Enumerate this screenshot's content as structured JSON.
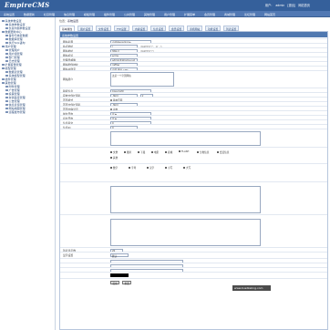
{
  "header": {
    "logo": "EmpireCMS",
    "user_prefix": "用户：",
    "user": "admin",
    "links": [
      "[退出]",
      "网站首页"
    ]
  },
  "nav": [
    "系统设置",
    "数据更新",
    "栏目管理",
    "信息管理",
    "模板管理",
    "插件管理",
    "公共管理",
    "其他管理",
    "用户管理",
    "扩展菜单",
    "会员管理",
    "商城管理",
    "论坛管理",
    "网站首页"
  ],
  "sidebar": {
    "items": [
      "系统参数设置",
      "系统参数设置",
      "负载均衡参数设置",
      "数据更新中心",
      "备份与恢复数据",
      "数据库管理",
      "执行SQL语句",
      "用户管理",
      "管理用户",
      "用户组管理",
      "部门管理",
      "日志管理",
      "扩展变量管理",
      "模型管理",
      "数据表管理",
      "系统模型管理",
      "插件管理",
      "其他管理",
      "附件管理",
      "广告管理",
      "投票管理",
      "友情链接管理",
      "公告管理",
      "信息反馈管理",
      "网站地图管理",
      "远程发布管理"
    ]
  },
  "crumb": {
    "prefix": "位置：",
    "path": "系统设置"
  },
  "tabs": [
    "基本属性",
    "用户设置",
    "文件设置",
    "FTP设置",
    "内容设置",
    "信息设置",
    "会员设置",
    "手机网站",
    "功能设置",
    "列表设置"
  ],
  "form": {
    "heading": "系统参数设置",
    "rows": [
      {
        "label": "网站名称",
        "value": "帝国网站管理系统"
      },
      {
        "label": "站点地址",
        "value": "/"
      },
      {
        "label": "网站地址",
        "value": "http://"
      },
      {
        "label": "网站标识",
        "value": "ecms"
      },
      {
        "label": "管理员邮箱",
        "value": "admin@phome.net"
      },
      {
        "label": "网站附件地址",
        "value": "/d/file/"
      },
      {
        "label": "网站关键字",
        "value": "帝国,网站,CMS"
      },
      {
        "label": "网站简介",
        "value": "这是一个帝国网站"
      },
      {
        "label": "版权信息",
        "value": "Copyright"
      },
      {
        "label": "存放文件扩展名",
        "value": ".html"
      },
      {
        "label": "首页模式",
        "value": "静态页面"
      },
      {
        "label": "首页文件扩展名",
        "value": ".html"
      },
      {
        "label": "首页内容显示",
        "value": "动态"
      },
      {
        "label": "前台开启",
        "value": "开启"
      },
      {
        "label": "后台开启",
        "value": "开启"
      },
      {
        "label": "信息提交",
        "value": "0"
      },
      {
        "label": "信息ID",
        "value": "0"
      },
      {
        "label": "列表显示数",
        "value": "20"
      },
      {
        "label": "显示设置",
        "value": "默认"
      }
    ],
    "hint_url": "(结尾需加\"/\"，如：/)",
    "hint_domain": "(结尾需加\"/\")",
    "checkbox_labels": [
      "文章",
      "图片",
      "下载",
      "电影",
      "商城",
      "FLASH",
      "分类信息",
      "会员信息",
      "其他",
      "数字",
      "字母",
      "汉字",
      "小写",
      "大写"
    ],
    "buttons": [
      "提交",
      "重置"
    ],
    "watermark": "www.kusdkeling.com"
  }
}
